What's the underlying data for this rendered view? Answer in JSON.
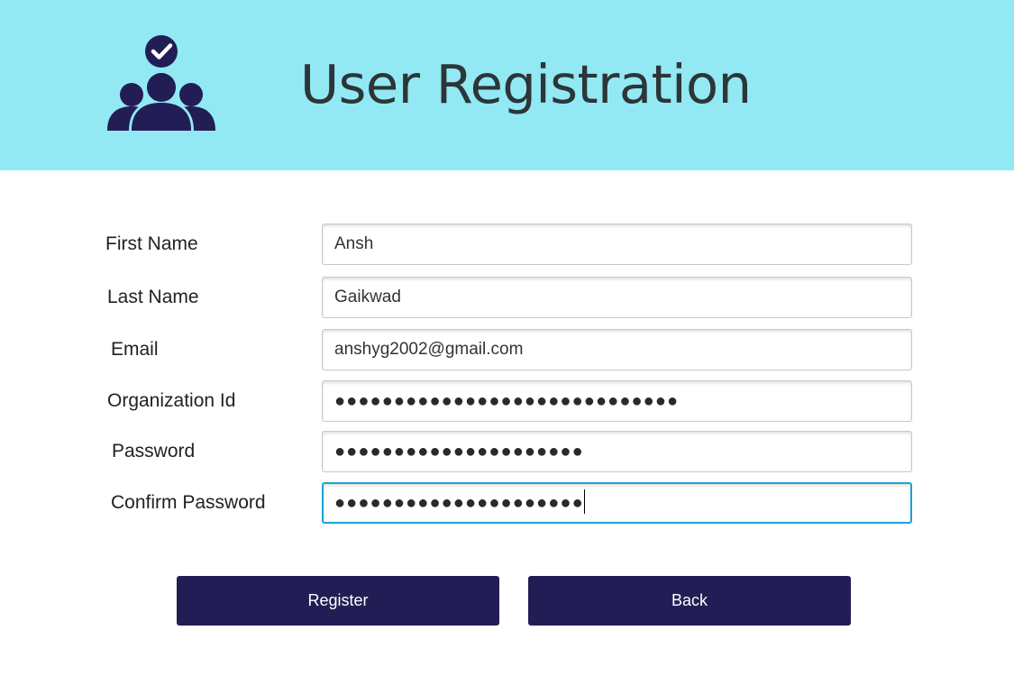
{
  "header": {
    "title": "User Registration",
    "logo_icon": "users-check-icon",
    "background": "#92e9f3"
  },
  "form": {
    "first_name": {
      "label": "First Name",
      "value": "Ansh"
    },
    "last_name": {
      "label": "Last Name",
      "value": "Gaikwad"
    },
    "email": {
      "label": "Email",
      "value": "anshyg2002@gmail.com"
    },
    "organization_id": {
      "label": "Organization Id",
      "value": "●●●●●●●●●●●●●●●●●●●●●●●●●●●●●"
    },
    "password": {
      "label": "Password",
      "value": "●●●●●●●●●●●●●●●●●●●●●"
    },
    "confirm_password": {
      "label": "Confirm Password",
      "value": "●●●●●●●●●●●●●●●●●●●●●"
    }
  },
  "buttons": {
    "register": "Register",
    "back": "Back",
    "color": "#221d54"
  },
  "accent": {
    "focus_border": "#1aa3d6"
  }
}
